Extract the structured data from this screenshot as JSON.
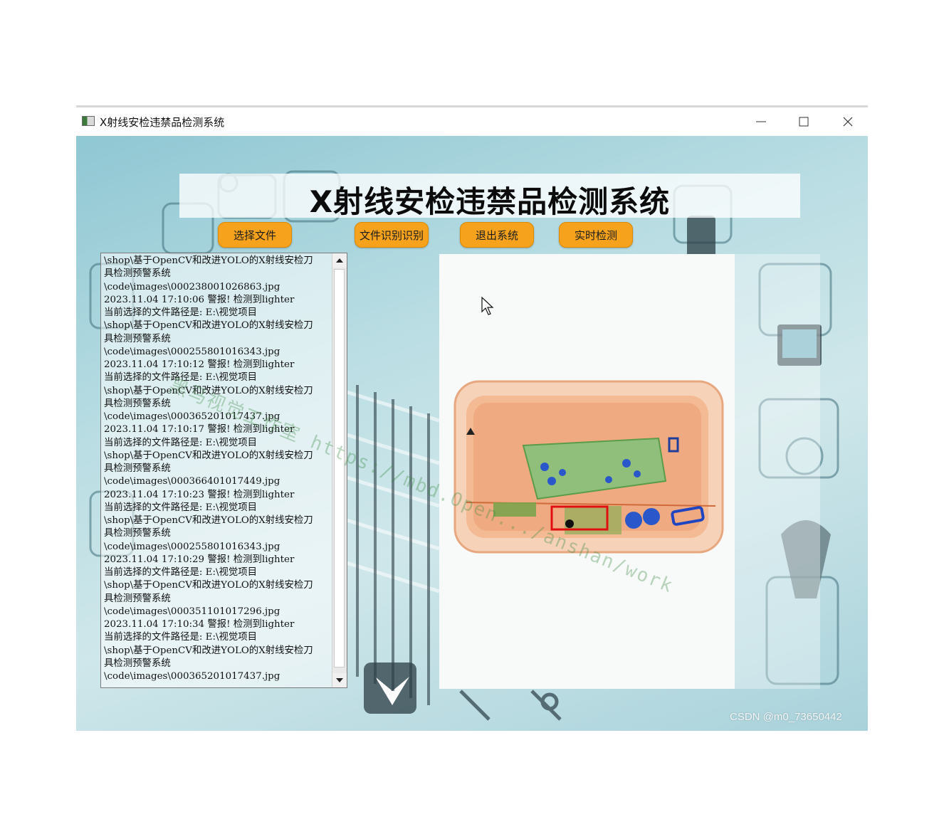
{
  "window": {
    "title": "X射线安检违禁品检测系统",
    "controls": [
      "minimize",
      "maximize",
      "close"
    ]
  },
  "banner": {
    "title": "X射线安检违禁品检测系统"
  },
  "buttons": {
    "select_file": "选择文件",
    "file_recognition": "文件识别识别",
    "exit_system": "退出系统",
    "realtime_detection": "实时检测"
  },
  "log": {
    "lines": [
      "\\shop\\基于OpenCV和改进YOLO的X射线安检刀",
      "具检测预警系统",
      "\\code\\images\\000238001026863.jpg",
      "2023.11.04 17:10:06 警报! 检测到lighter",
      "当前选择的文件路径是: E:\\视觉项目",
      "\\shop\\基于OpenCV和改进YOLO的X射线安检刀",
      "具检测预警系统",
      "\\code\\images\\000255801016343.jpg",
      "2023.11.04 17:10:12 警报! 检测到lighter",
      "当前选择的文件路径是: E:\\视觉项目",
      "\\shop\\基于OpenCV和改进YOLO的X射线安检刀",
      "具检测预警系统",
      "\\code\\images\\000365201017437.jpg",
      "2023.11.04 17:10:17 警报! 检测到lighter",
      "当前选择的文件路径是: E:\\视觉项目",
      "\\shop\\基于OpenCV和改进YOLO的X射线安检刀",
      "具检测预警系统",
      "\\code\\images\\000366401017449.jpg",
      "2023.11.04 17:10:23 警报! 检测到lighter",
      "当前选择的文件路径是: E:\\视觉项目",
      "\\shop\\基于OpenCV和改进YOLO的X射线安检刀",
      "具检测预警系统",
      "\\code\\images\\000255801016343.jpg",
      "2023.11.04 17:10:29 警报! 检测到lighter",
      "当前选择的文件路径是: E:\\视觉项目",
      "\\shop\\基于OpenCV和改进YOLO的X射线安检刀",
      "具检测预警系统",
      "\\code\\images\\000351101017296.jpg",
      "2023.11.04 17:10:34 警报! 检测到lighter",
      "当前选择的文件路径是: E:\\视觉项目",
      "\\shop\\基于OpenCV和改进YOLO的X射线安检刀",
      "具检测预警系统",
      "\\code\\images\\000365201017437.jpg"
    ]
  },
  "detection": {
    "label": "lighter",
    "box_color": "#e01010"
  },
  "watermark": "CSDN @m0_73650442",
  "overlay_watermark": "黑马视觉工作室 https://mbd.Open.../anshan/work",
  "colors": {
    "button_bg": "#f7a21c",
    "titlebar_bg": "#ffffff",
    "background_accent": "#8fc7d3"
  },
  "icons": [
    "app-icon",
    "minimize-icon",
    "maximize-icon",
    "close-icon",
    "cursor-icon",
    "scroll-up-icon",
    "scroll-down-icon"
  ]
}
